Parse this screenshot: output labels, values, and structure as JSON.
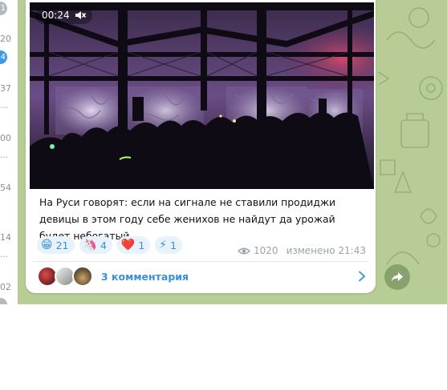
{
  "left_strip": {
    "markers": [
      "20",
      "37",
      "00",
      "54",
      "14",
      "02"
    ],
    "badge_top": "1",
    "badge_blue": "4"
  },
  "video": {
    "time": "00:24",
    "icon": "muted-speaker-icon"
  },
  "post": {
    "caption": "На Руси говорят: если на сигнале не ставили продиджи девицы в этом году себе женихов не найдут да урожай будет небогатый"
  },
  "reactions": [
    {
      "emoji": "😁",
      "count": "21"
    },
    {
      "emoji": "🦄",
      "count": "4"
    },
    {
      "emoji": "❤️",
      "count": "1"
    },
    {
      "emoji": "⚡",
      "count": "1"
    }
  ],
  "meta": {
    "views": "1020",
    "edited_label": "изменено 21:43"
  },
  "comments": {
    "label": "3 комментария"
  },
  "colors": {
    "accent": "#3a8fd6",
    "chat_bg": "#b7cd95",
    "reaction_bg": "#e7f2fb"
  }
}
